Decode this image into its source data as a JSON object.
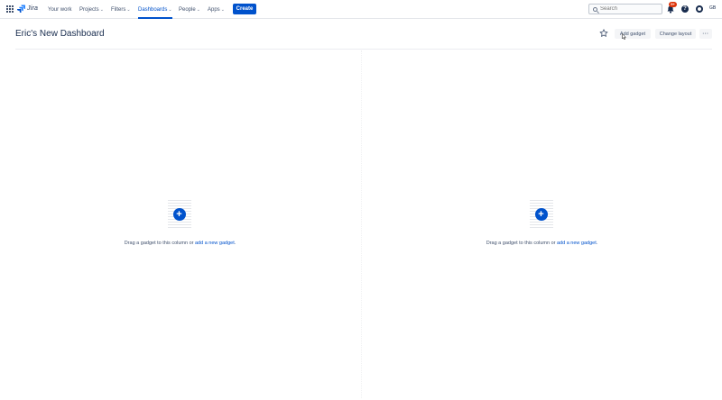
{
  "nav": {
    "logo_text": "Jira",
    "items": [
      {
        "label": "Your work"
      },
      {
        "label": "Projects"
      },
      {
        "label": "Filters"
      },
      {
        "label": "Dashboards"
      },
      {
        "label": "People"
      },
      {
        "label": "Apps"
      }
    ],
    "create_label": "Create",
    "search_placeholder": "Search",
    "notification_count": "9+",
    "help_glyph": "?",
    "avatar_initials": "GB",
    "active_item": "Dashboards",
    "accent_color": "#0052cc"
  },
  "page": {
    "title": "Eric's New Dashboard",
    "add_gadget_label": "Add gadget",
    "change_layout_label": "Change layout",
    "more_label": "···"
  },
  "columns": [
    {
      "text_prefix": "Drag a gadget to this column or ",
      "link_text": "add a new gadget",
      "text_suffix": "."
    },
    {
      "text_prefix": "Drag a gadget to this column or ",
      "link_text": "add a new gadget",
      "text_suffix": "."
    }
  ]
}
